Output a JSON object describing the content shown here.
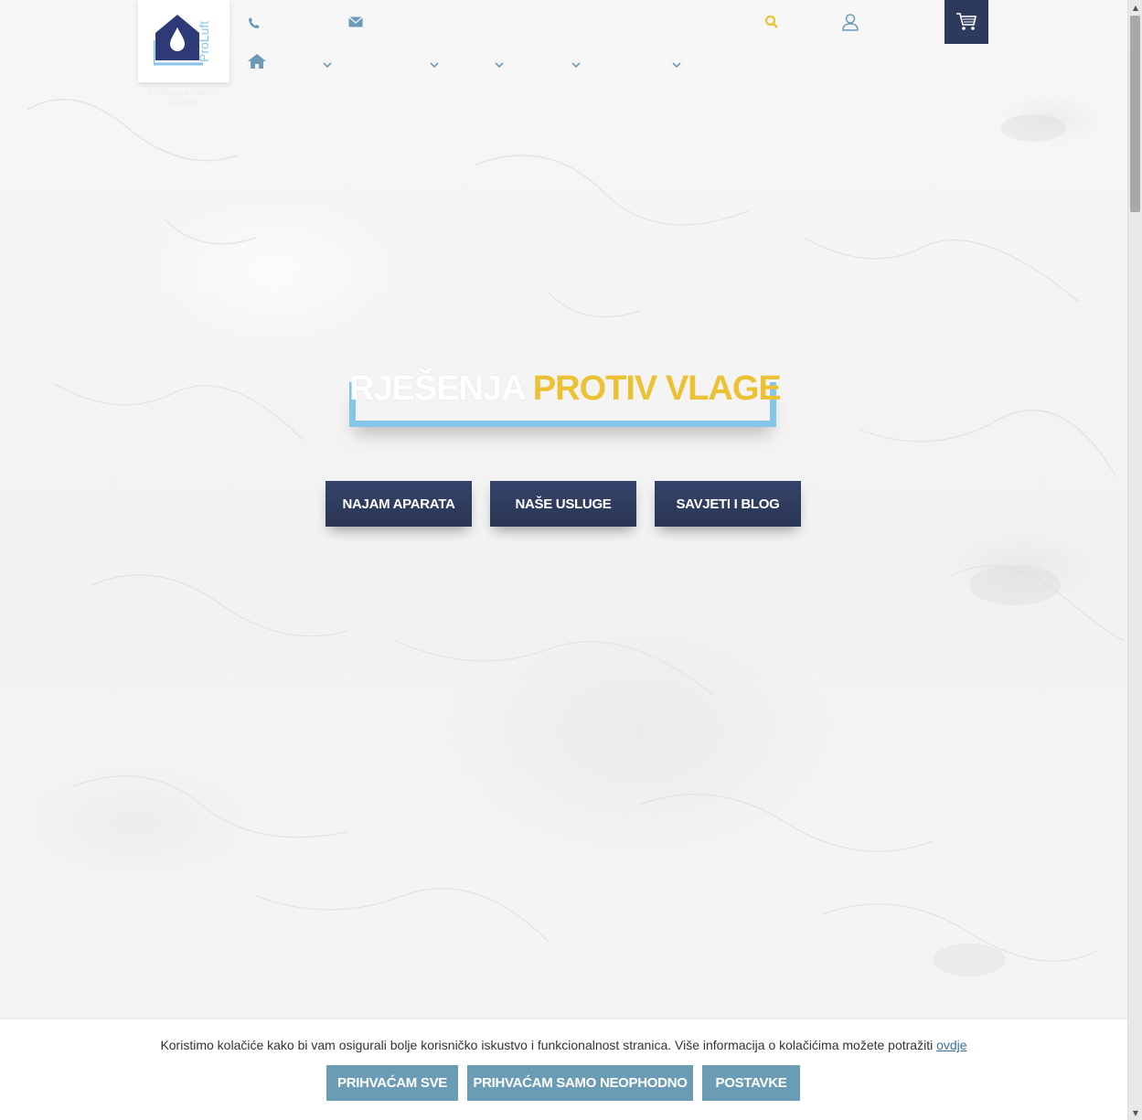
{
  "header": {
    "logo_brand": "ProLuft",
    "logo_tagline": "RJEŠENJA PROTIV VLAGE",
    "icons": {
      "phone": "phone-icon",
      "email": "envelope-icon",
      "search": "search-icon",
      "account": "user-icon",
      "cart": "cart-icon",
      "home": "home-icon"
    },
    "nav_dropdown_count": 5
  },
  "hero": {
    "title_part1": "RJEŠENJA",
    "title_part2": "PROTIV VLAGE",
    "buttons": [
      {
        "label": "NAJAM APARATA"
      },
      {
        "label": "NAŠE USLUGE"
      },
      {
        "label": "SAVJETI I BLOG"
      }
    ]
  },
  "cookie": {
    "text": "Koristimo kolačiće kako bi vam osigurali bolje korisničko iskustvo i funkcionalnost stranica. Više informacija o kolačićima možete potražiti",
    "link_label": "ovdje",
    "buttons": [
      {
        "label": "PRIHVAĆAM SVE"
      },
      {
        "label": "PRIHVAĆAM SAMO NEOPHODNO"
      },
      {
        "label": "POSTAVKE"
      }
    ]
  },
  "colors": {
    "navy": "#2e3a5c",
    "accent_blue": "#85c6e8",
    "accent_yellow": "#ecc234",
    "cookie_button": "#6b9cb6",
    "icon_blue": "#6a9ab8"
  }
}
